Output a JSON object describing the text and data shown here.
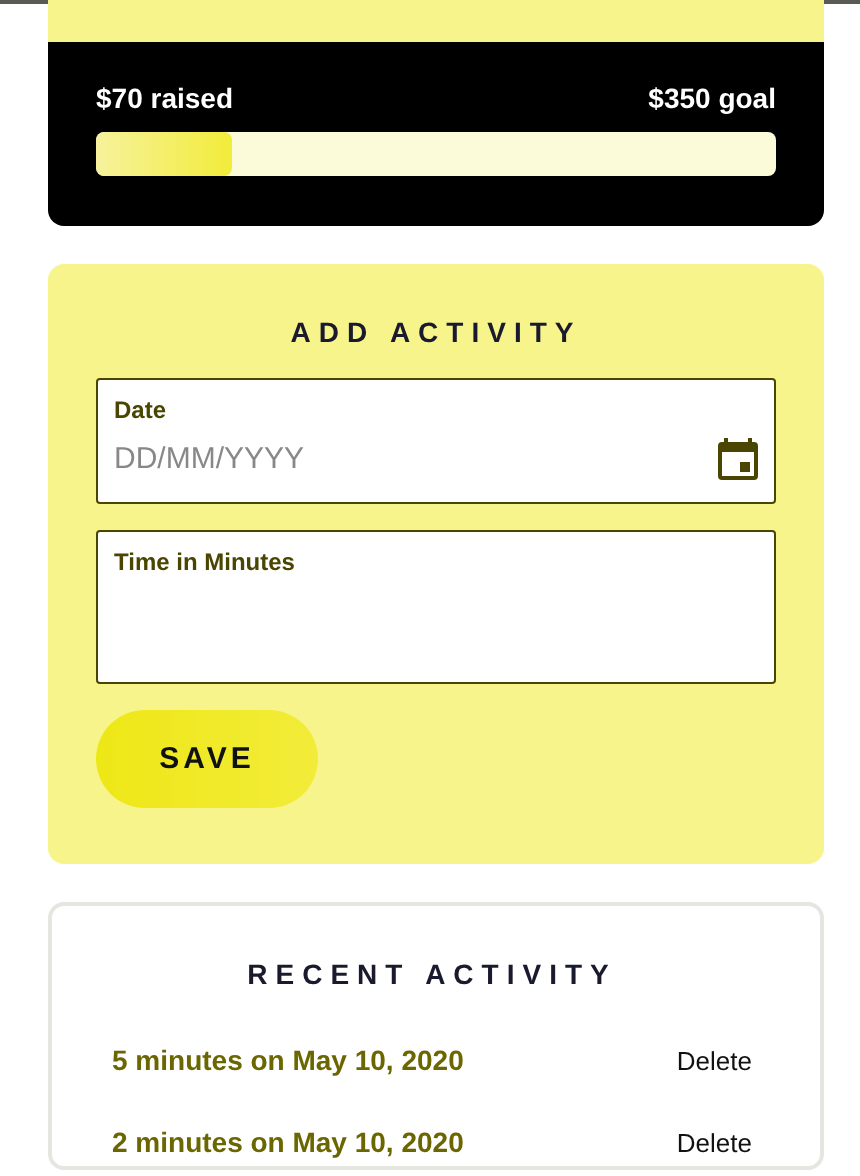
{
  "fundraiser": {
    "raised": "$70 raised",
    "goal": "$350 goal",
    "level": 0.2
  },
  "add_activity": {
    "title": "ADD ACTIVITY",
    "fields": [
      {
        "kind": "date",
        "label": "Date",
        "placeholder": "DD/MM/YYYY"
      },
      {
        "kind": "number",
        "label": "Time in Minutes"
      }
    ],
    "button": "SAVE"
  },
  "recent_activity": {
    "title": "RECENT ACTIVITY",
    "items": [
      {
        "text": "5 minutes on May 10, 2020",
        "action": "Delete"
      },
      {
        "text": "2 minutes on May 10, 2020",
        "action": "Delete"
      }
    ]
  }
}
